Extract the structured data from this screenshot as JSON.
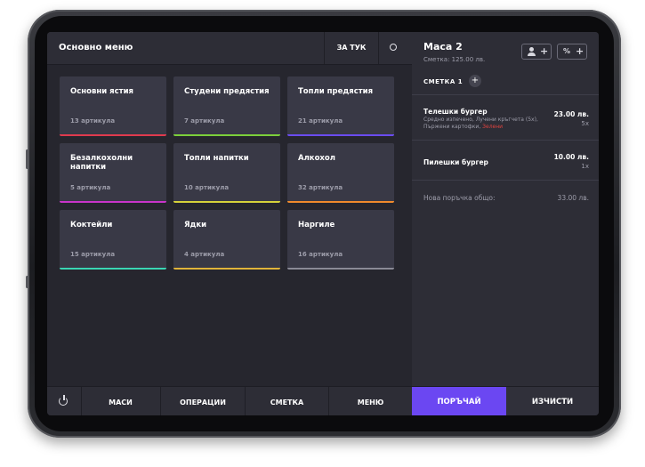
{
  "menu": {
    "title": "Основно меню",
    "for_here_label": "ЗА ТУК",
    "categories": [
      {
        "name": "Основни ястия",
        "count": "13 артикула",
        "color": "#e03a4e"
      },
      {
        "name": "Студени предястия",
        "count": "7 артикула",
        "color": "#7ccf3a"
      },
      {
        "name": "Топли предястия",
        "count": "21 артикула",
        "color": "#6a4cf0"
      },
      {
        "name": "Безалкохолни напитки",
        "count": "5 артикула",
        "color": "#c934c9"
      },
      {
        "name": "Топли напитки",
        "count": "10 артикула",
        "color": "#d6d23a"
      },
      {
        "name": "Алкохол",
        "count": "32 артикула",
        "color": "#f08a2c"
      },
      {
        "name": "Коктейли",
        "count": "15 артикула",
        "color": "#3ad6b4"
      },
      {
        "name": "Ядки",
        "count": "4 артикула",
        "color": "#e0b43a"
      },
      {
        "name": "Наргиле",
        "count": "16 артикула",
        "color": "#8a8a96"
      }
    ]
  },
  "nav": {
    "tables": "МАСИ",
    "operations": "ОПЕРАЦИИ",
    "bill": "СМЕТКА",
    "menu": "МЕНЮ"
  },
  "order": {
    "table_name": "Маса 2",
    "bill_total": "Сметка: 125.00 лв.",
    "bill_tab": "СМЕТКА 1",
    "add_symbol": "+",
    "percent_symbol": "%",
    "items": [
      {
        "name": "Телешки бургер",
        "mods_text": "Средно изпечено, Лучени кръгчета (5x), Пържени картофки,",
        "mods_removed": "Зелени",
        "price": "23.00 лв.",
        "qty": "5x"
      },
      {
        "name": "Пилешки бургер",
        "mods_text": "",
        "mods_removed": "",
        "price": "10.00 лв.",
        "qty": "1x"
      }
    ],
    "new_total_label": "Нова поръчка общо:",
    "new_total_value": "33.00 лв.",
    "order_button": "ПОРЪЧАЙ",
    "clear_button": "ИЗЧИСТИ"
  },
  "colors": {
    "accent": "#6b47f2",
    "background": "#26262e",
    "panel": "#2d2d36",
    "tile": "#393946"
  }
}
